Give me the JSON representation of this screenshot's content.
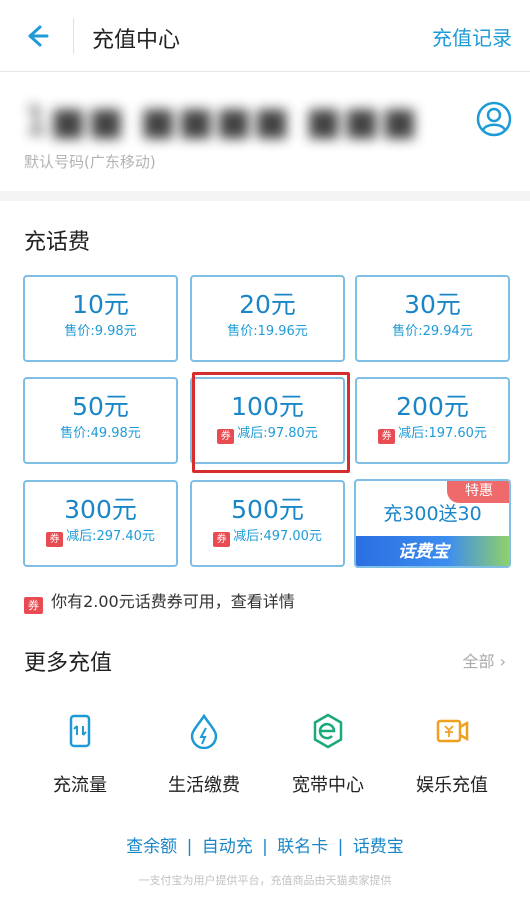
{
  "header": {
    "title": "充值中心",
    "record_link": "充值记录"
  },
  "phone": {
    "number_masked": "1■■ ■■■■ ■■■",
    "hint": "默认号码(广东移动)"
  },
  "recharge": {
    "title": "充话费",
    "cards": [
      {
        "amount": "10元",
        "price": "售价:9.98元",
        "coupon": false
      },
      {
        "amount": "20元",
        "price": "售价:19.96元",
        "coupon": false
      },
      {
        "amount": "30元",
        "price": "售价:29.94元",
        "coupon": false
      },
      {
        "amount": "50元",
        "price": "售价:49.98元",
        "coupon": false
      },
      {
        "amount": "100元",
        "price": "减后:97.80元",
        "coupon": true
      },
      {
        "amount": "200元",
        "price": "减后:197.60元",
        "coupon": true
      },
      {
        "amount": "300元",
        "price": "减后:297.40元",
        "coupon": true
      },
      {
        "amount": "500元",
        "price": "减后:497.00元",
        "coupon": true
      }
    ],
    "promo": {
      "text": "充300送30",
      "badge": "特惠",
      "banner": "话费宝"
    },
    "coupon_tag": "券",
    "coupon_note": "你有2.00元话费券可用，查看详情"
  },
  "more": {
    "title": "更多充值",
    "all_link": "全部",
    "services": [
      {
        "label": "充流量",
        "icon": "phone-data-icon"
      },
      {
        "label": "生活缴费",
        "icon": "water-drop-bolt-icon"
      },
      {
        "label": "宽带中心",
        "icon": "broadband-e-icon"
      },
      {
        "label": "娱乐充值",
        "icon": "entertainment-ticket-icon"
      }
    ]
  },
  "footer": {
    "links": [
      "查余额",
      "自动充",
      "联名卡",
      "话费宝"
    ],
    "disclaimer": "一支付宝为用户提供平台，充值商品由天猫卖家提供"
  },
  "colors": {
    "accent": "#1e9bd7",
    "card_border": "#7fbfe6",
    "coupon_red": "#e84c52",
    "highlight_red": "#d62d2d"
  }
}
